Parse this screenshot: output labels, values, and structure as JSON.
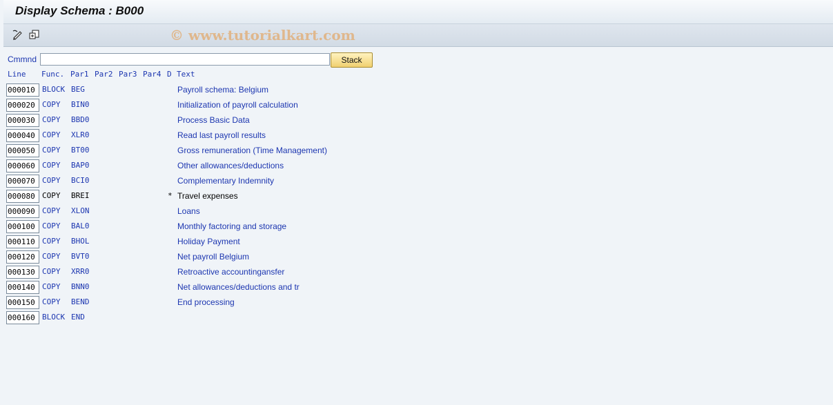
{
  "window": {
    "title": "Display Schema : B000"
  },
  "toolbar": {
    "icons": [
      "edit-pencil-icon",
      "other-object-icon"
    ]
  },
  "watermark": "© www.tutorialkart.com",
  "command": {
    "label": "Cmmnd",
    "value": "",
    "stack_label": "Stack"
  },
  "headers": {
    "line": "Line",
    "func": "Func.",
    "par1": "Par1",
    "par2": "Par2",
    "par3": "Par3",
    "par4": "Par4",
    "d": "D",
    "text": "Text"
  },
  "rows": [
    {
      "line": "000010",
      "func": "BLOCK",
      "par1": "BEG",
      "flag": "",
      "text": "Payroll schema: Belgium"
    },
    {
      "line": "000020",
      "func": "COPY",
      "par1": "BIN0",
      "flag": "",
      "text": "Initialization of payroll calculation"
    },
    {
      "line": "000030",
      "func": "COPY",
      "par1": "BBD0",
      "flag": "",
      "text": "Process Basic Data"
    },
    {
      "line": "000040",
      "func": "COPY",
      "par1": "XLR0",
      "flag": "",
      "text": "Read last payroll results"
    },
    {
      "line": "000050",
      "func": "COPY",
      "par1": "BT00",
      "flag": "",
      "text": "Gross remuneration (Time Management)"
    },
    {
      "line": "000060",
      "func": "COPY",
      "par1": "BAP0",
      "flag": "",
      "text": "Other allowances/deductions"
    },
    {
      "line": "000070",
      "func": "COPY",
      "par1": "BCI0",
      "flag": "",
      "text": "Complementary Indemnity"
    },
    {
      "line": "000080",
      "func": "COPY",
      "par1": "BREI",
      "flag": "*",
      "text": "Travel expenses"
    },
    {
      "line": "000090",
      "func": "COPY",
      "par1": "XLON",
      "flag": "",
      "text": "Loans"
    },
    {
      "line": "000100",
      "func": "COPY",
      "par1": "BAL0",
      "flag": "",
      "text": "Monthly factoring and storage"
    },
    {
      "line": "000110",
      "func": "COPY",
      "par1": "BHOL",
      "flag": "",
      "text": "Holiday Payment"
    },
    {
      "line": "000120",
      "func": "COPY",
      "par1": "BVT0",
      "flag": "",
      "text": "Net payroll Belgium"
    },
    {
      "line": "000130",
      "func": "COPY",
      "par1": "XRR0",
      "flag": "",
      "text": "Retroactive accountingansfer"
    },
    {
      "line": "000140",
      "func": "COPY",
      "par1": "BNN0",
      "flag": "",
      "text": "Net allowances/deductions and tr"
    },
    {
      "line": "000150",
      "func": "COPY",
      "par1": "BEND",
      "flag": "",
      "text": "End processing"
    },
    {
      "line": "000160",
      "func": "BLOCK",
      "par1": "END",
      "flag": "",
      "text": ""
    }
  ]
}
